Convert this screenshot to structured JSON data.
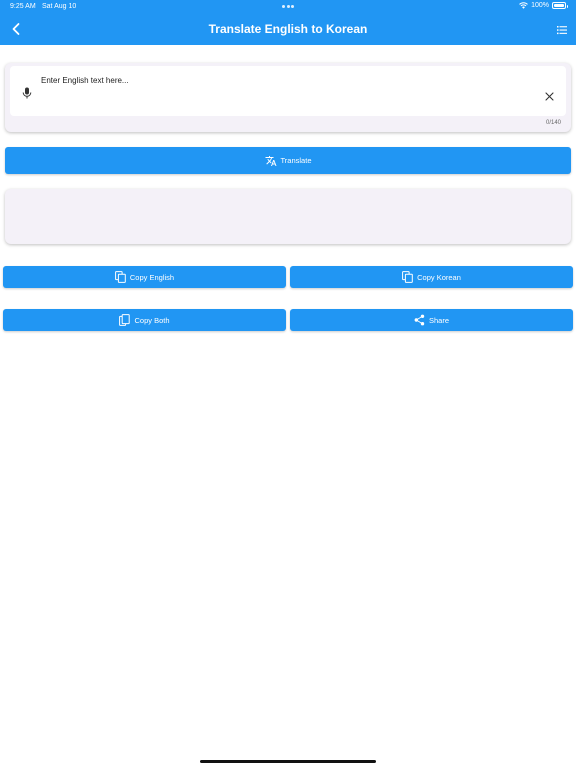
{
  "status_bar": {
    "time": "9:25 AM",
    "date": "Sat Aug 10",
    "battery": "100%"
  },
  "header": {
    "title": "Translate English to Korean",
    "back_icon": "chevron-left-icon",
    "menu_icon": "list-icon"
  },
  "input": {
    "placeholder": "Enter English text here...",
    "char_count": "0/140",
    "mic_icon": "mic-icon",
    "clear_icon": "close-icon"
  },
  "buttons": {
    "translate": "Translate",
    "copy_english": "Copy English",
    "copy_korean": "Copy Korean",
    "copy_both": "Copy Both",
    "share": "Share"
  },
  "colors": {
    "primary": "#2196f3",
    "card_bg": "#f4f1f8",
    "page_bg": "#ffffff"
  }
}
